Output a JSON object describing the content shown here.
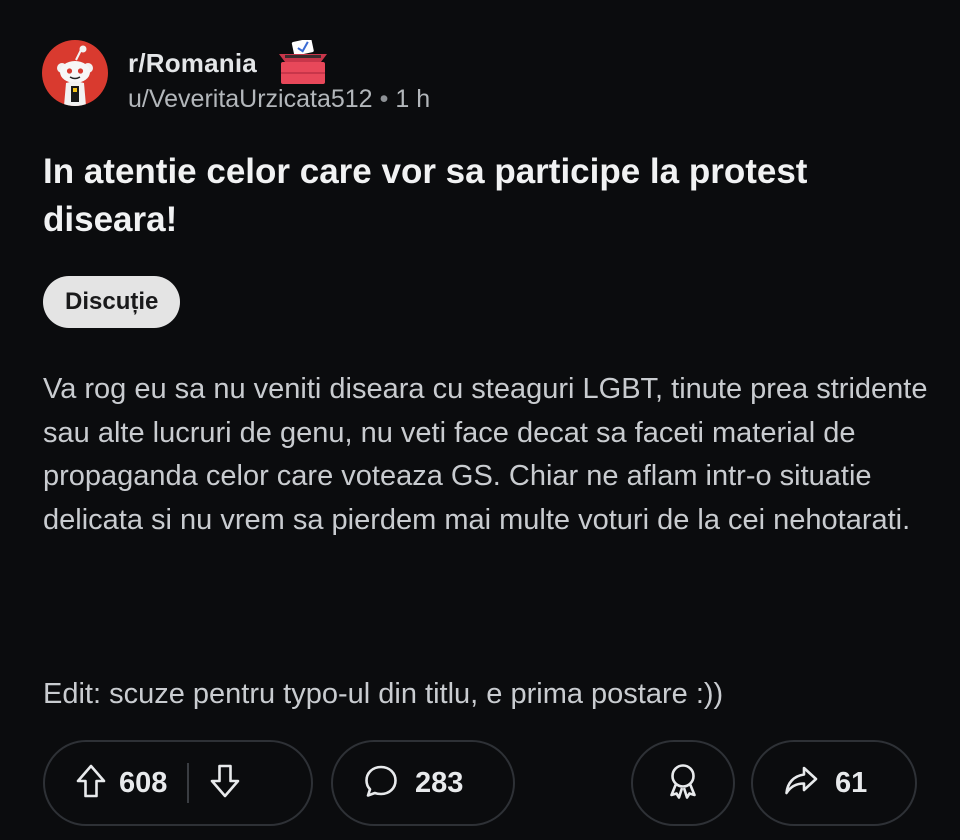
{
  "post": {
    "subreddit": "r/Romania",
    "author": "u/VeveritaUrzicata512",
    "separator": "•",
    "age": "1 h",
    "title": "In atentie celor care vor sa participe la protest diseara!",
    "flair": "Discuție",
    "body": "Va rog eu sa nu veniti diseara cu steaguri LGBT, tinute prea stridente sau alte lucruri de genu, nu veti face decat sa faceti material de propaganda celor care voteaza GS. Chiar ne aflam intr-o situatie delicata si nu vrem sa pierdem mai multe voturi de la cei nehotarati.",
    "edit": "Edit: scuze pentru typo-ul din titlu, e prima postare :))"
  },
  "actions": {
    "upvotes": "608",
    "comments": "283",
    "shares": "61"
  },
  "icons": {
    "avatar": "snoo-avatar-icon",
    "flair": "ballot-box-icon",
    "upvote": "upvote-arrow-icon",
    "downvote": "downvote-arrow-icon",
    "comment": "comment-bubble-icon",
    "award": "award-icon",
    "share": "share-arrow-icon"
  },
  "colors": {
    "background": "#0b0c0e",
    "avatar_bg": "#d93a2f",
    "flair_bg": "#e4e4e4",
    "ballot_box": "#e8485a"
  }
}
